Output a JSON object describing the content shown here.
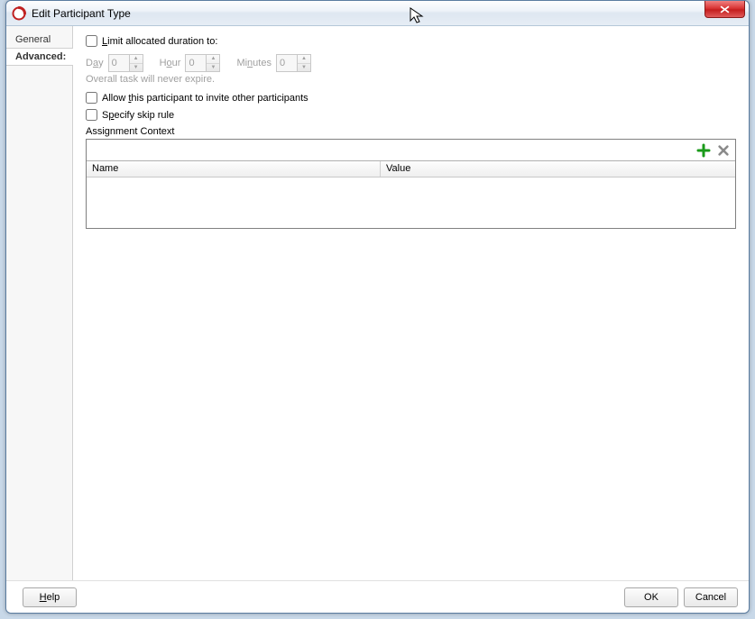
{
  "window": {
    "title": "Edit Participant Type"
  },
  "tabs": {
    "general": "General",
    "advanced": "Advanced:"
  },
  "opts": {
    "limit_label_pre": "L",
    "limit_label_post": "imit allocated duration to:",
    "allow_pre": "Allow ",
    "allow_u": "t",
    "allow_post": "his participant to invite other participants",
    "skip_pre": "S",
    "skip_u": "p",
    "skip_post": "ecify skip rule"
  },
  "duration": {
    "day_pre": "D",
    "day_u": "a",
    "day_post": "y",
    "day_val": "0",
    "hour_pre": "H",
    "hour_u": "o",
    "hour_post": "ur",
    "hour_val": "0",
    "min_pre": "Mi",
    "min_u": "n",
    "min_post": "utes",
    "min_val": "0",
    "hint": "Overall task will never expire."
  },
  "assignment": {
    "label": "Assignment Context",
    "col_name": "Name",
    "col_value": "Value"
  },
  "buttons": {
    "help_u": "H",
    "help_post": "elp",
    "ok": "OK",
    "cancel": "Cancel"
  }
}
